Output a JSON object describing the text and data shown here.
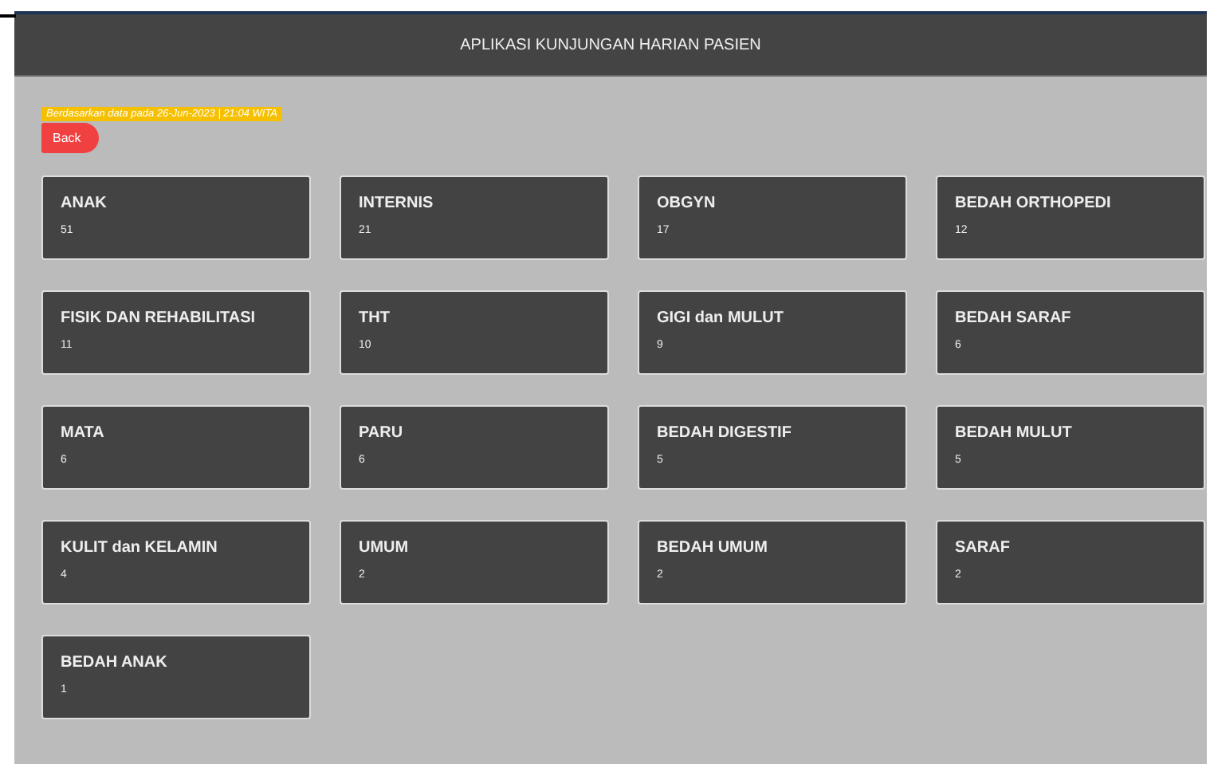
{
  "header": {
    "title": "APLIKASI KUNJUNGAN HARIAN PASIEN"
  },
  "info": "Berdasarkan data pada 26-Jun-2023 | 21:04 WITA",
  "back_button": "Back",
  "cards": [
    {
      "name": "ANAK",
      "count": "51"
    },
    {
      "name": "INTERNIS",
      "count": "21"
    },
    {
      "name": "OBGYN",
      "count": "17"
    },
    {
      "name": "BEDAH ORTHOPEDI",
      "count": "12"
    },
    {
      "name": "FISIK DAN REHABILITASI",
      "count": "11"
    },
    {
      "name": "THT",
      "count": "10"
    },
    {
      "name": "GIGI dan MULUT",
      "count": "9"
    },
    {
      "name": "BEDAH SARAF",
      "count": "6"
    },
    {
      "name": "MATA",
      "count": "6"
    },
    {
      "name": "PARU",
      "count": "6"
    },
    {
      "name": "BEDAH DIGESTIF",
      "count": "5"
    },
    {
      "name": "BEDAH MULUT",
      "count": "5"
    },
    {
      "name": "KULIT dan KELAMIN",
      "count": "4"
    },
    {
      "name": "UMUM",
      "count": "2"
    },
    {
      "name": "BEDAH UMUM",
      "count": "2"
    },
    {
      "name": "SARAF",
      "count": "2"
    },
    {
      "name": "BEDAH ANAK",
      "count": "1"
    }
  ]
}
